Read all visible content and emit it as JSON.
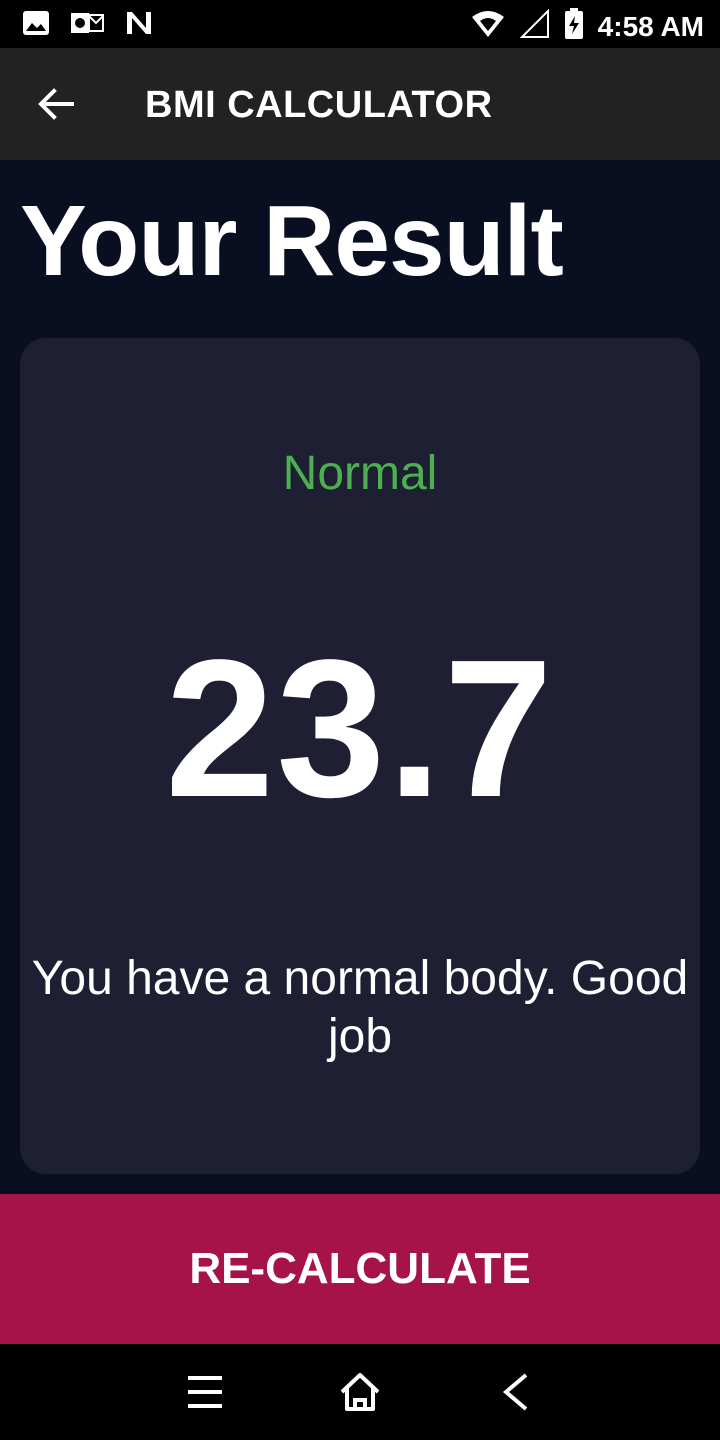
{
  "status_bar": {
    "time": "4:58 AM",
    "left_icons": [
      "image-icon",
      "outlook-icon",
      "n-icon"
    ],
    "right_icons": [
      "wifi-icon",
      "signal-icon",
      "battery-charging-icon"
    ]
  },
  "app_bar": {
    "title": "BMI CALCULATOR",
    "back_icon": "arrow-left-icon"
  },
  "page": {
    "title": "Your Result"
  },
  "result": {
    "category": "Normal",
    "bmi": "23.7",
    "message": "You have a normal body. Good job"
  },
  "actions": {
    "recalculate_label": "RE-CALCULATE"
  },
  "nav_bar": {
    "items": [
      "menu-icon",
      "home-icon",
      "back-icon"
    ]
  },
  "colors": {
    "background": "#0a0e21",
    "card": "#1e1f33",
    "category_green": "#4caf50",
    "button": "#a51348",
    "app_bar": "#222222"
  }
}
